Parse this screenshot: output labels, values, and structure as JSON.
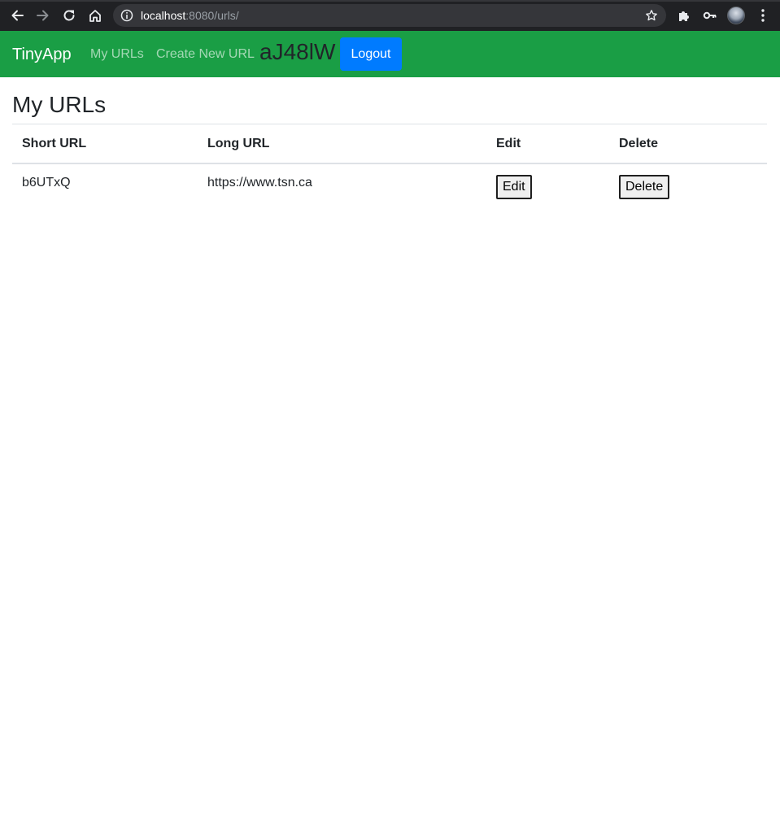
{
  "browser": {
    "url_host": "localhost",
    "url_rest": ":8080/urls/",
    "icons": [
      "back-arrow-icon",
      "forward-arrow-icon",
      "reload-icon",
      "home-icon",
      "info-icon",
      "star-icon",
      "puzzle-icon",
      "key-icon",
      "avatar",
      "menu-dots-icon"
    ]
  },
  "navbar": {
    "brand": "TinyApp",
    "links": [
      "My URLs",
      "Create New URL"
    ],
    "user_id": "aJ48lW",
    "logout_label": "Logout",
    "colors": {
      "background": "#1a9e45",
      "logout": "#007bff"
    }
  },
  "main": {
    "title": "My URLs",
    "table": {
      "headers": [
        "Short URL",
        "Long URL",
        "Edit",
        "Delete"
      ],
      "rows": [
        {
          "short_url": "b6UTxQ",
          "long_url": "https://www.tsn.ca",
          "edit_label": "Edit",
          "delete_label": "Delete"
        }
      ]
    }
  }
}
